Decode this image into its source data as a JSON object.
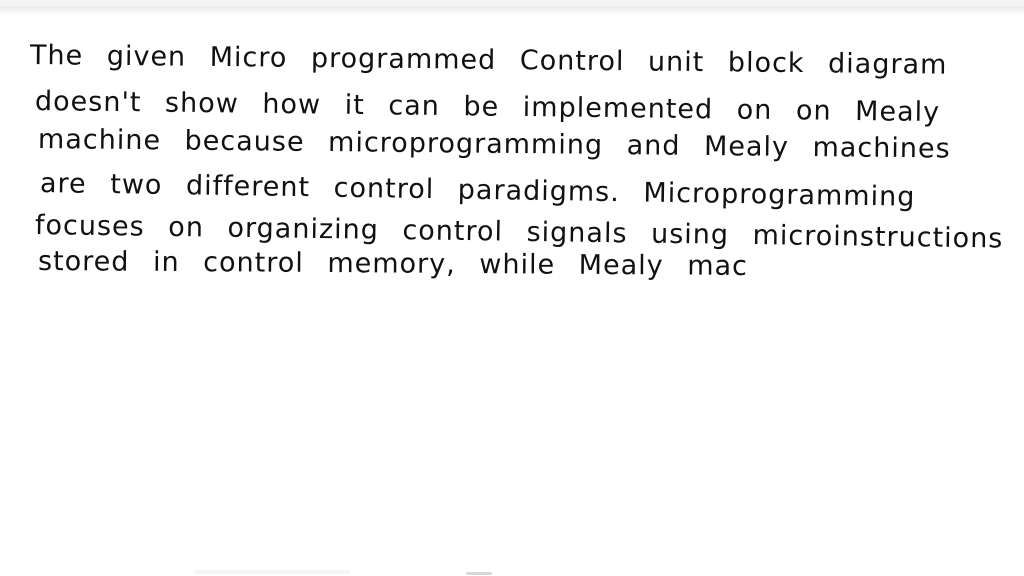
{
  "document": {
    "type": "handwritten-note",
    "lines": [
      "The given Micro programmed Control unit block diagram",
      "doesn't show how it can be implemented on on Mealy",
      "machine because microprogramming and Mealy machines",
      "are two different control paradigms. Microprogramming",
      "focuses on organizing control signals using microinstructions",
      "stored in control memory, while Mealy mac"
    ]
  },
  "colors": {
    "ink": "#111111",
    "background": "#ffffff"
  }
}
